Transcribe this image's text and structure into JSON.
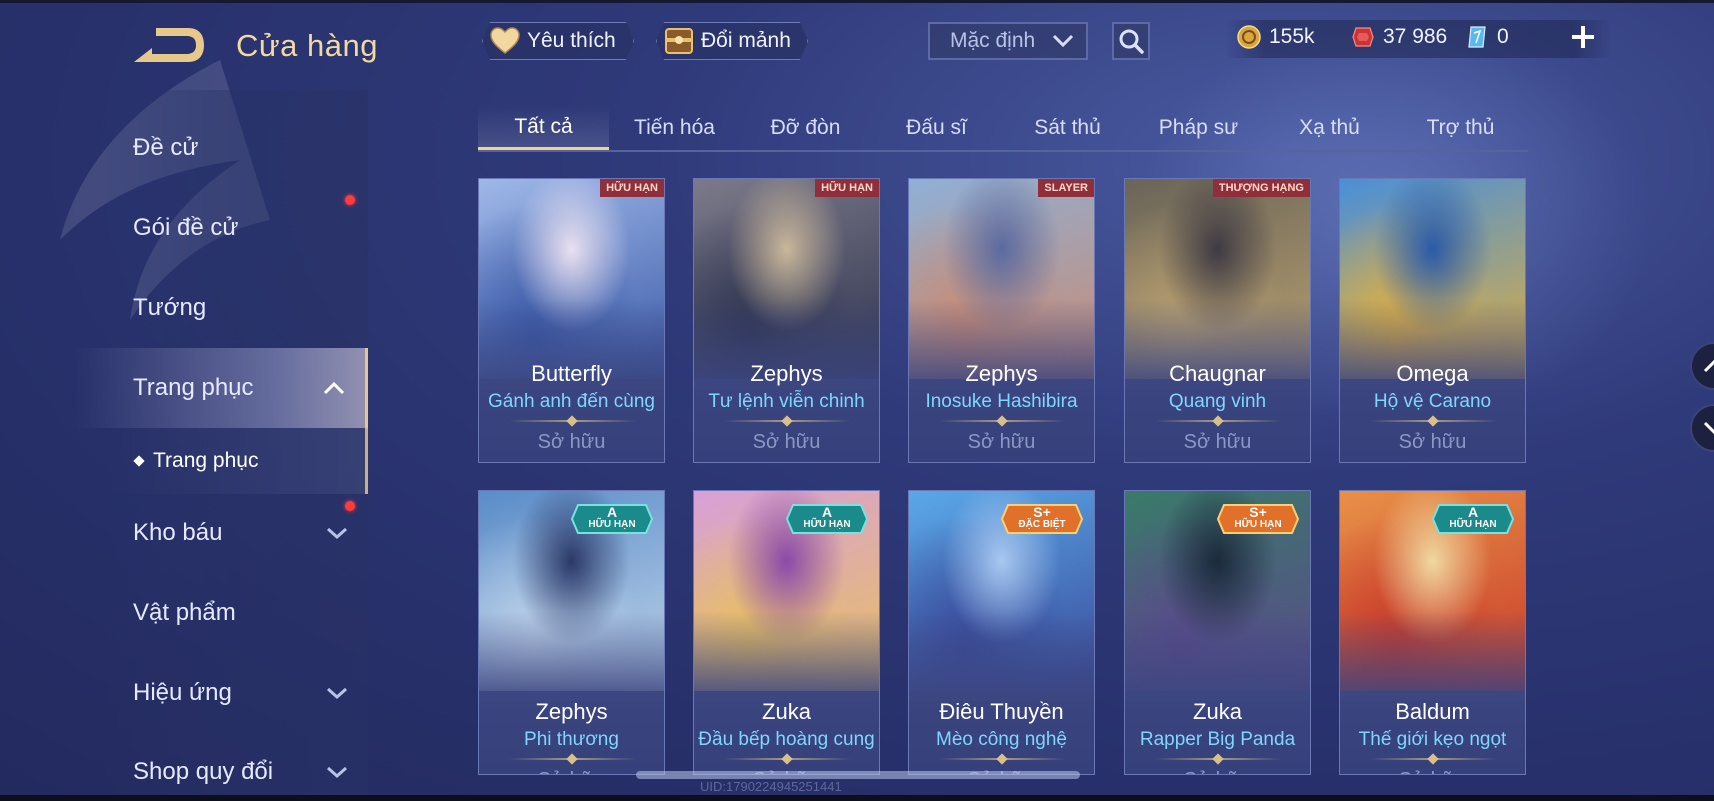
{
  "header": {
    "title": "Cửa hàng",
    "favorites_label": "Yêu thích",
    "shard_label": "Đổi mảnh",
    "sort_value": "Mặc định"
  },
  "currency": {
    "gold": "155k",
    "voucher": "37 986",
    "gem": "0"
  },
  "sidebar": {
    "items": [
      {
        "label": "Đề cử"
      },
      {
        "label": "Gói đề cử"
      },
      {
        "label": "Tướng"
      },
      {
        "label": "Trang phục"
      },
      {
        "label": "Kho báu"
      },
      {
        "label": "Vật phẩm"
      },
      {
        "label": "Hiệu ứng"
      },
      {
        "label": "Shop quy đổi"
      }
    ],
    "sub_item": "Trang phục"
  },
  "tabs": [
    "Tất cả",
    "Tiến hóa",
    "Đỡ đòn",
    "Đấu sĩ",
    "Sát thủ",
    "Pháp sư",
    "Xạ thủ",
    "Trợ thủ"
  ],
  "cards": [
    {
      "hero": "Butterfly",
      "skin": "Gánh anh đến cùng",
      "status": "Sở hữu",
      "tier": "",
      "badge": "HỮU HẠN",
      "colors": [
        "#9fb8e8",
        "#3b5aa8",
        "#e9e0f0"
      ]
    },
    {
      "hero": "Zephys",
      "skin": "Tư lệnh viễn chinh",
      "status": "Sở hữu",
      "tier": "",
      "badge": "HỮU HẠN",
      "colors": [
        "#7c7a8a",
        "#2f3450",
        "#c9b79a"
      ]
    },
    {
      "hero": "Zephys",
      "skin": "Inosuke Hashibira",
      "status": "Sở hữu",
      "tier": "",
      "badge": "SLAYER",
      "colors": [
        "#8fb0d6",
        "#c98b74",
        "#5a6aa0"
      ]
    },
    {
      "hero": "Chaugnar",
      "skin": "Quang vinh",
      "status": "Sở hữu",
      "tier": "",
      "badge": "THƯỢNG HẠNG",
      "colors": [
        "#6a6458",
        "#b8a070",
        "#3e3a44"
      ]
    },
    {
      "hero": "Omega",
      "skin": "Hộ vệ Carano",
      "status": "Sở hữu",
      "tier": "",
      "badge": "",
      "colors": [
        "#4a8fd8",
        "#e0b040",
        "#2a5aa8"
      ]
    },
    {
      "hero": "Zephys",
      "skin": "Phi thương",
      "status": "Sở hữu",
      "tier": "A",
      "badge": "HỮU HẠN",
      "colors": [
        "#5a8cc8",
        "#c0d4ea",
        "#2a3868"
      ]
    },
    {
      "hero": "Zuka",
      "skin": "Đầu bếp hoàng cung",
      "status": "Sở hữu",
      "tier": "A",
      "badge": "HỮU HẠN",
      "colors": [
        "#d8a0d8",
        "#e8c060",
        "#8a4aa8"
      ]
    },
    {
      "hero": "Điêu Thuyền",
      "skin": "Mèo công nghệ",
      "status": "Sở hữu",
      "tier": "S+",
      "badge": "ĐẶC BIỆT",
      "colors": [
        "#5aa8e8",
        "#3a4a9a",
        "#a8c8f0"
      ]
    },
    {
      "hero": "Zuka",
      "skin": "Rapper Big Panda",
      "status": "Sở hữu",
      "tier": "S+",
      "badge": "HỮU HẠN",
      "colors": [
        "#3a7a6a",
        "#5a4a8a",
        "#1a2a3a"
      ]
    },
    {
      "hero": "Baldum",
      "skin": "Thế giới kẹo ngọt",
      "status": "Sở hữu",
      "tier": "A",
      "badge": "HỮU HẠN",
      "colors": [
        "#e89048",
        "#c83a2a",
        "#f0d8a0"
      ]
    }
  ],
  "uid_text": "UID:1790224945251441",
  "colors": {
    "accent_gold": "#f2d9a0",
    "skin_name": "#7fd6ff",
    "notification": "#ff3b3b"
  },
  "icons": {
    "back": "back-arrow-icon",
    "favorites": "heart-icon",
    "shard": "chest-icon",
    "search": "search-icon",
    "gold": "gold-coin-icon",
    "voucher": "red-voucher-icon",
    "gem": "blue-gem-icon",
    "add": "plus-icon"
  }
}
